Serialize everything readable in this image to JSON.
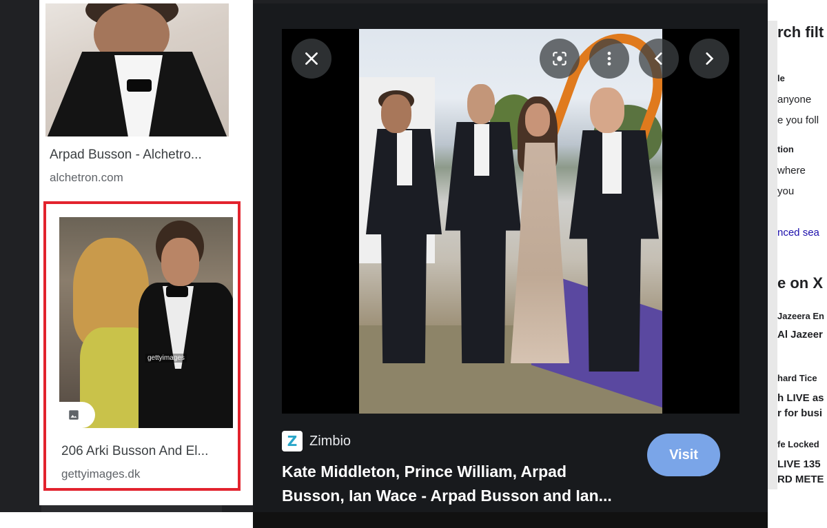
{
  "left_results": [
    {
      "title": "Arpad Busson - Alchetro...",
      "source": "alchetron.com"
    },
    {
      "title": "206 Arki Busson And El...",
      "source": "gettyimages.dk",
      "watermark": "gettyimages"
    }
  ],
  "viewer": {
    "controls": {
      "close": "close-icon",
      "lens": "lens-icon",
      "more": "more-vert-icon",
      "prev": "chevron-left-icon",
      "next": "chevron-right-icon"
    },
    "source": {
      "favicon_letter": "Z",
      "name": "Zimbio"
    },
    "caption": "Kate Middleton, Prince William, Arpad Busson, Ian Wace - Arpad Busson and Ian...",
    "visit_label": "Visit"
  },
  "right_sidebar": [
    "rch filt",
    "le",
    "anyone",
    "e you foll",
    "tion",
    "where",
    "you",
    "nced sea",
    "e on X",
    "Jazeera En",
    "Al Jazeer",
    "hard Tice",
    "h LIVE as",
    "r for busi",
    "fe Locked",
    "LIVE 135",
    "RD METE"
  ],
  "colors": {
    "accent_visit": "#7aa5e8",
    "selection_border": "#e2232e",
    "viewer_bg": "#181a1d"
  }
}
